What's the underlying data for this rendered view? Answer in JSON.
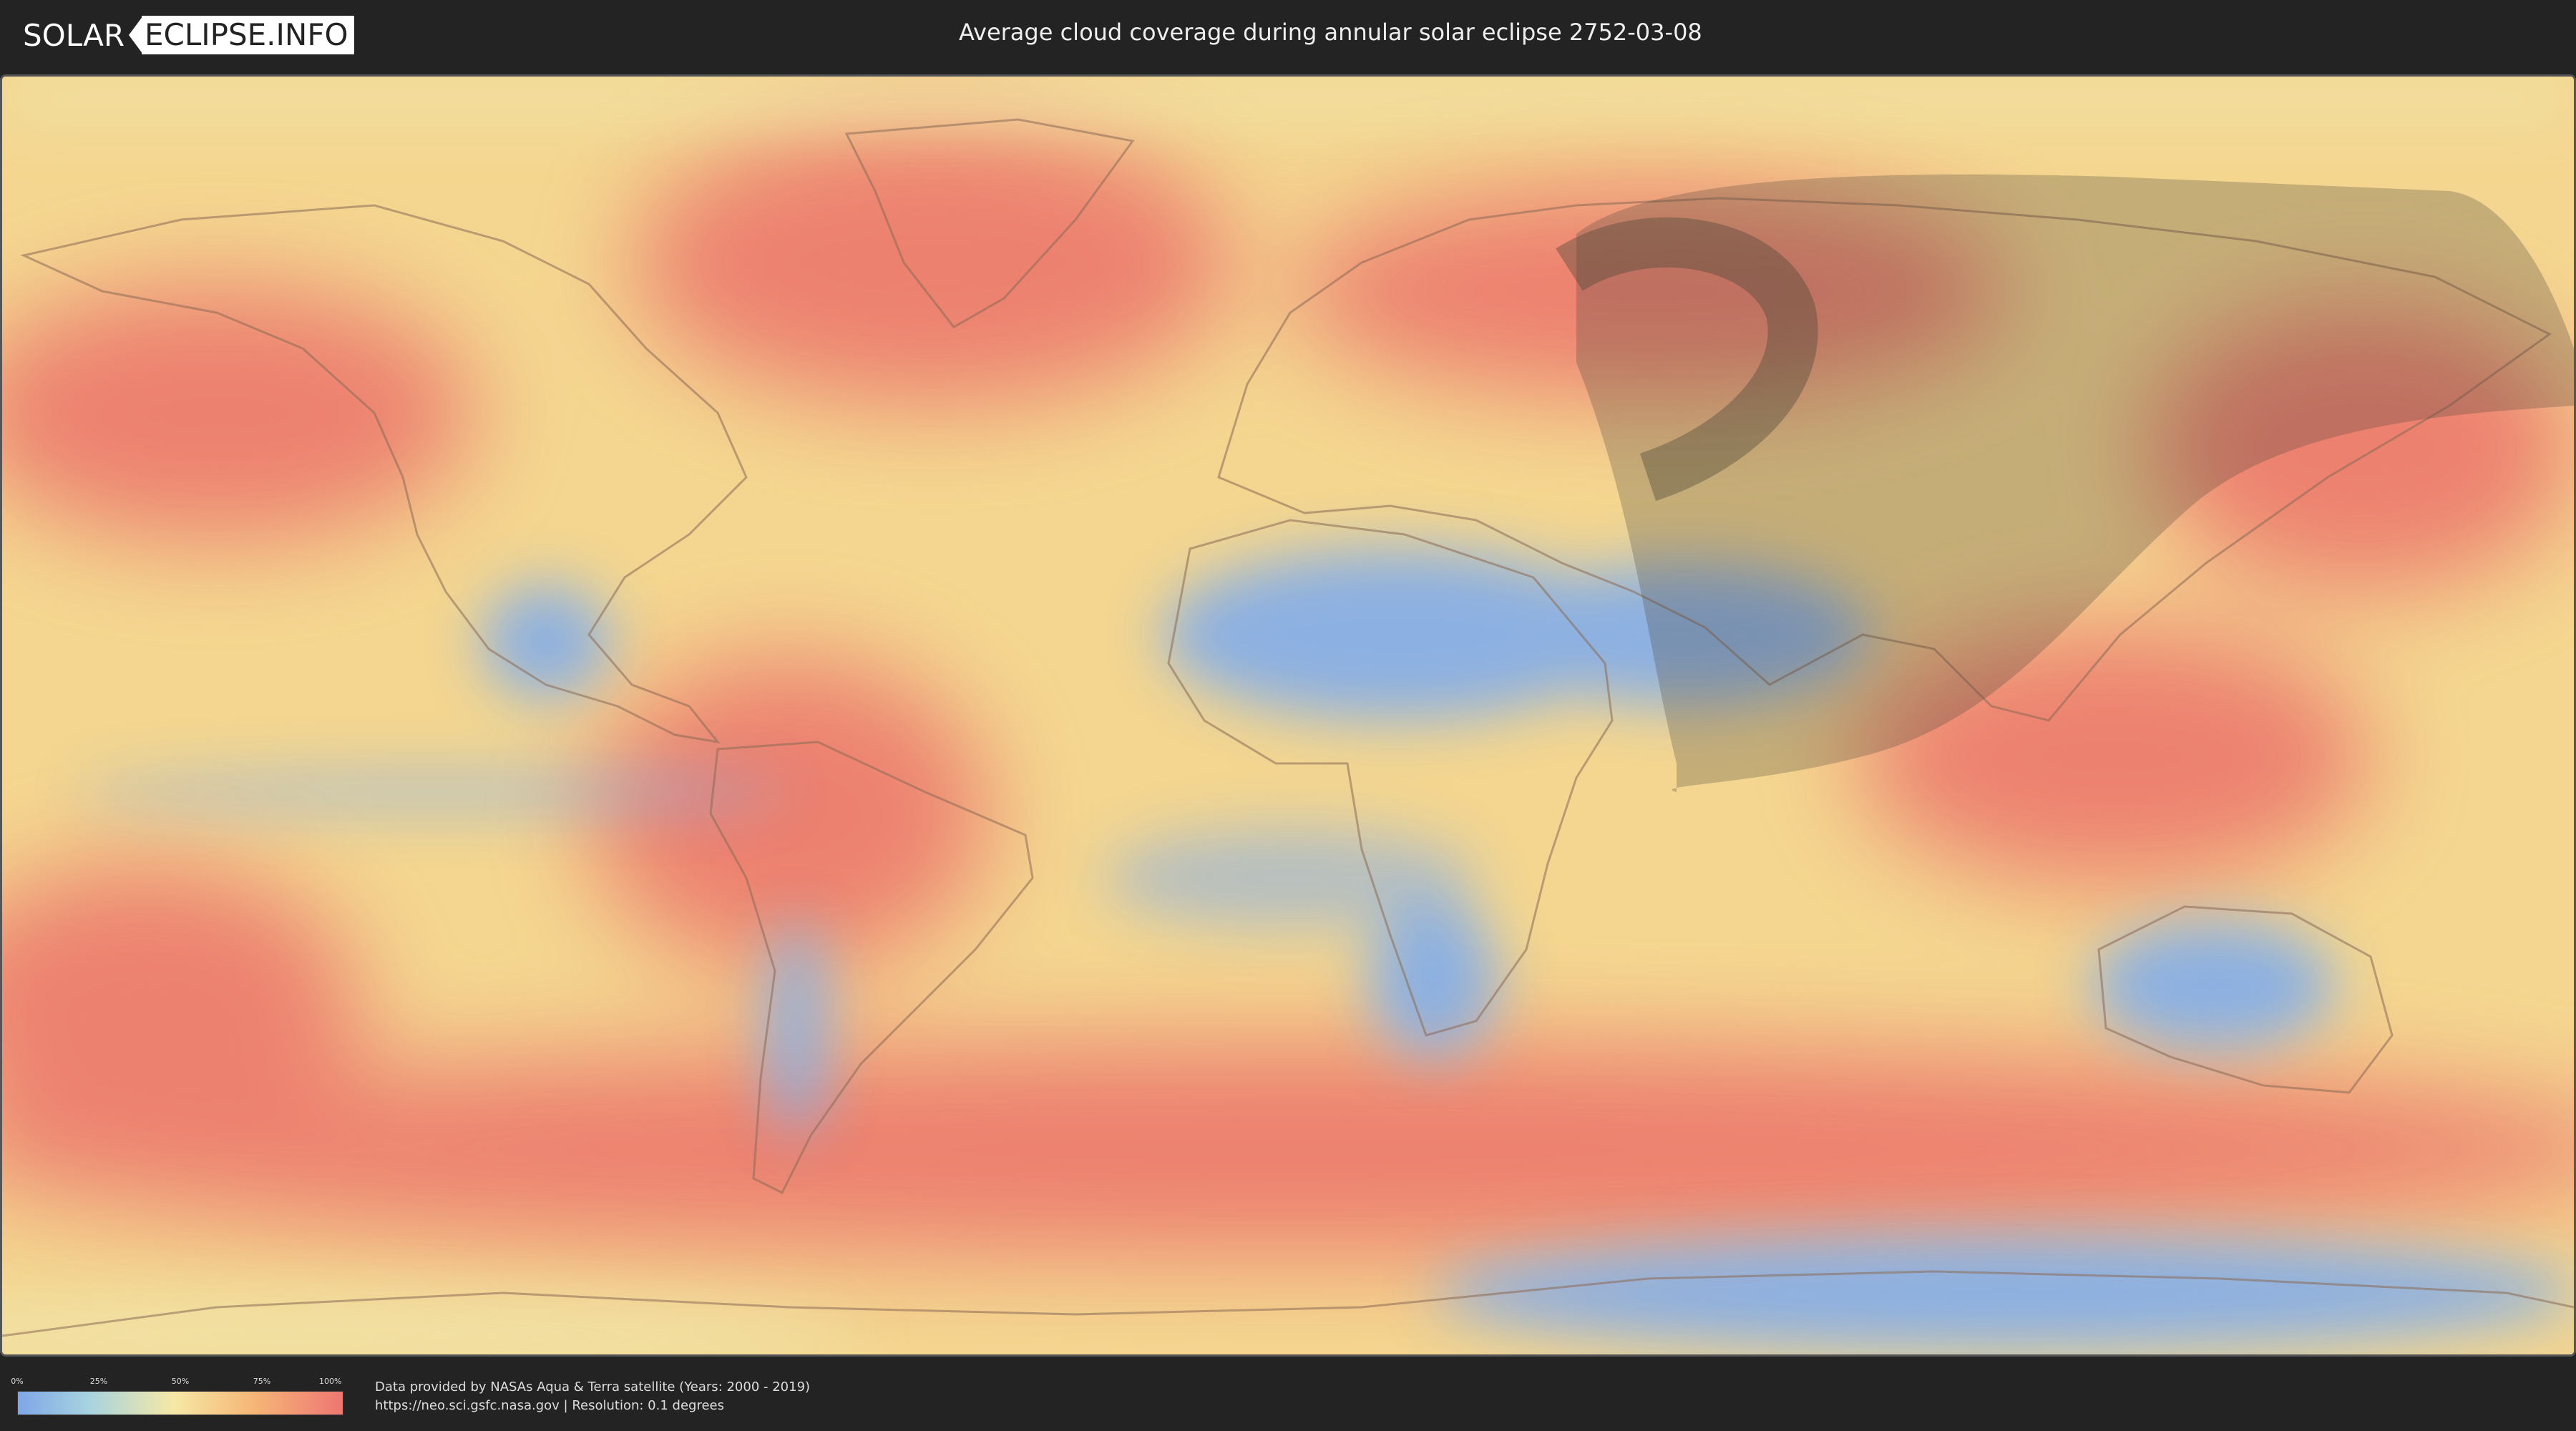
{
  "header": {
    "logo_left": "SOLAR",
    "logo_right": "ECLIPSE.INFO",
    "title": "Average cloud coverage during annular solar eclipse 2752-03-08"
  },
  "legend": {
    "ticks": [
      "0%",
      "25%",
      "50%",
      "75%",
      "100%"
    ],
    "colors": [
      "#7ea6e8",
      "#a8d3df",
      "#f6e8a5",
      "#f6b777",
      "#ee7672"
    ]
  },
  "credits": {
    "line1": "Data provided by NASAs Aqua & Terra satellite (Years: 2000 - 2019)",
    "line2": "https://neo.sci.gsfc.nasa.gov | Resolution: 0.1 degrees"
  },
  "map": {
    "overlay_color": "#5a5446",
    "land_low_cloud_color": "#86aee6",
    "ocean_high_cloud_color": "#ea7b6e",
    "mid_cloud_color": "#f5d791"
  }
}
